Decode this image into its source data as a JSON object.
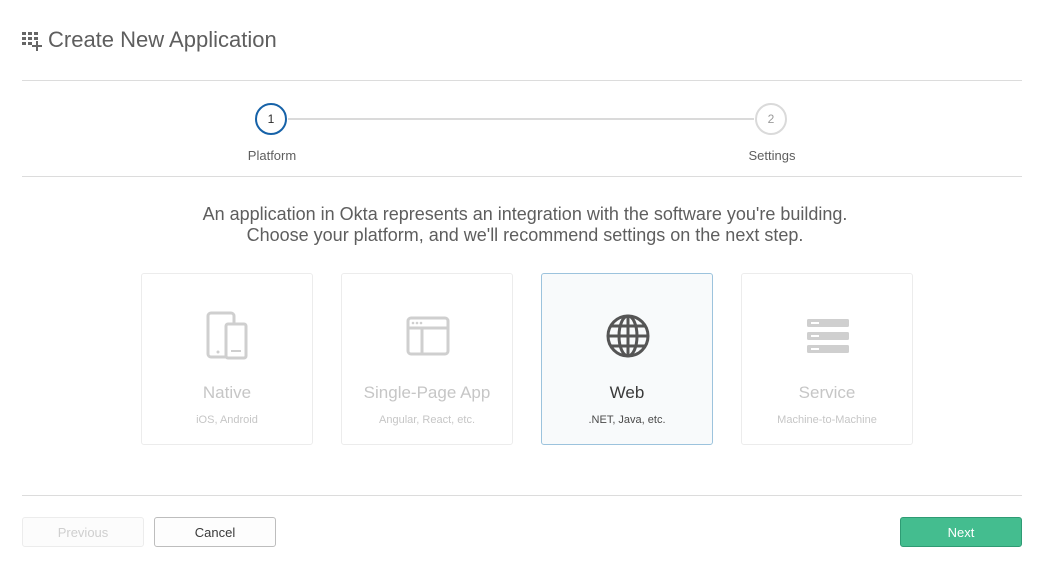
{
  "header": {
    "title": "Create New Application",
    "icon": "add-apps-icon"
  },
  "stepper": {
    "steps": [
      {
        "number": "1",
        "label": "Platform",
        "state": "active"
      },
      {
        "number": "2",
        "label": "Settings",
        "state": "inactive"
      }
    ],
    "active_color": "#1662a8"
  },
  "intro": {
    "line1": "An application in Okta represents an integration with the software you're building.",
    "line2": "Choose your platform, and we'll recommend settings on the next step."
  },
  "platforms": [
    {
      "title": "Native",
      "subtitle": "iOS, Android",
      "icon": "mobile-devices-icon",
      "selected": false
    },
    {
      "title": "Single-Page App",
      "subtitle": "Angular, React, etc.",
      "icon": "browser-window-icon",
      "selected": false
    },
    {
      "title": "Web",
      "subtitle": ".NET, Java, etc.",
      "icon": "globe-icon",
      "selected": true
    },
    {
      "title": "Service",
      "subtitle": "Machine-to-Machine",
      "icon": "server-stack-icon",
      "selected": false
    }
  ],
  "footer": {
    "previous_label": "Previous",
    "cancel_label": "Cancel",
    "next_label": "Next",
    "next_color": "#44bd8f"
  }
}
